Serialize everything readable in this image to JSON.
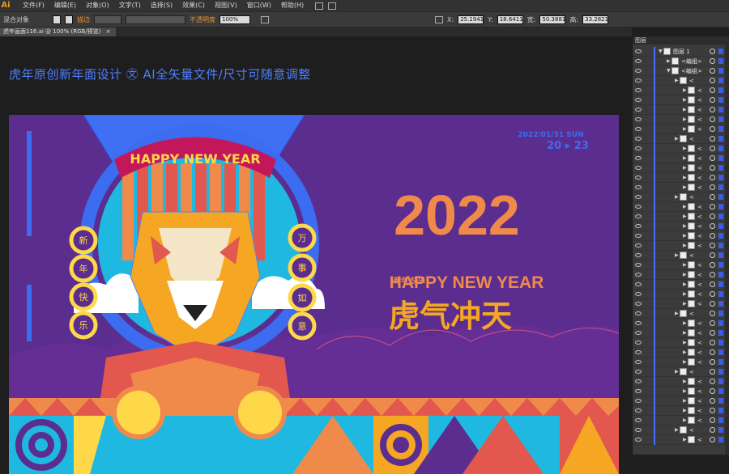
{
  "app": {
    "logo": "Ai"
  },
  "menu": [
    "文件(F)",
    "编辑(E)",
    "对象(O)",
    "文字(T)",
    "选择(S)",
    "效果(C)",
    "视图(V)",
    "窗口(W)",
    "帮助(H)"
  ],
  "control_bar": {
    "selection_label": "混合对象",
    "stroke_label": "描边",
    "opacity_label": "不透明度",
    "opacity_value": "100%",
    "x_label": "X:",
    "x_value": "25.1941",
    "y_label": "Y:",
    "y_value": "18.6411",
    "w_label": "宽:",
    "w_value": "50.3881",
    "h_label": "高:",
    "h_value": "33.2821"
  },
  "document_tab": {
    "label": "虎年画面116.ai @ 100% (RGB/预览)",
    "close": "×"
  },
  "canvas": {
    "header_text": "虎年原创新年面设计  ㉆ AI全矢量文件/尺寸可随意调整",
    "art": {
      "banner": "HAPPY NEW YEAR",
      "year": "2022",
      "happy_new_year": "HAPPY NEW YEAR",
      "tiger_slogan": "虎气冲天",
      "left_circles": [
        "新",
        "年",
        "快",
        "乐"
      ],
      "right_circles": [
        "万",
        "事",
        "如",
        "意"
      ],
      "small_prefix": "新年\n快乐",
      "date_line1": "2022/01/31 SUN",
      "date_line2": "20 ▸ 23"
    }
  },
  "layers_panel": {
    "title": "图层",
    "top_layer": "图层 1",
    "group1": "<编组>",
    "group2": "<编组>",
    "item_marker": "<"
  },
  "colors": {
    "artboard_purple": "#5b2d8e",
    "accent_orange": "#f08a4b",
    "header_blue": "#4f7fff",
    "selection_blue": "#3d5ce6"
  }
}
